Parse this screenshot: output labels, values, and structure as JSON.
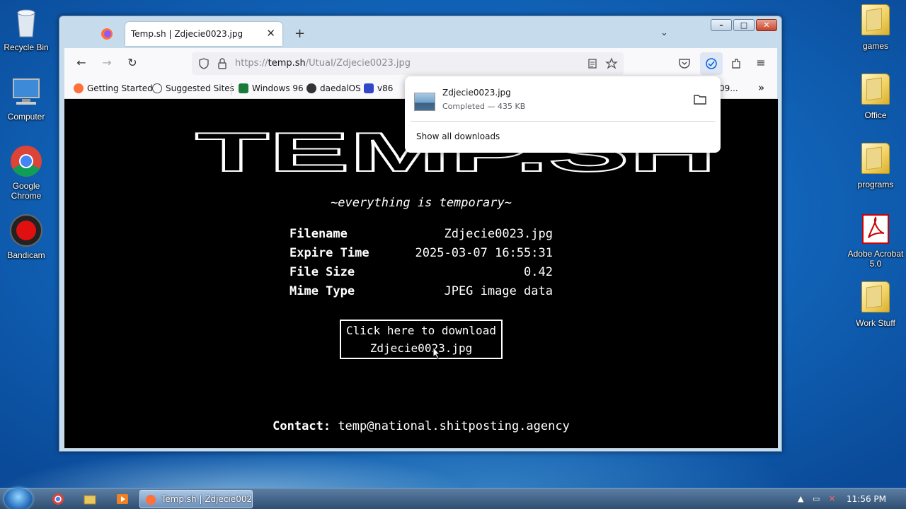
{
  "desktop": {
    "left_icons": [
      {
        "label": "Recycle Bin"
      },
      {
        "label": "Computer"
      },
      {
        "label": "Google Chrome"
      },
      {
        "label": "Bandicam"
      }
    ],
    "right_icons": [
      {
        "label": "games"
      },
      {
        "label": "Office"
      },
      {
        "label": "programs"
      },
      {
        "label": "Adobe Acrobat 5.0"
      },
      {
        "label": "Work Stuff"
      }
    ]
  },
  "browser": {
    "tab_title": "Temp.sh | Zdjecie0023.jpg",
    "new_tab": "+",
    "tab_close": "✕",
    "url_prefix": "https://",
    "url_host": "temp.sh",
    "url_path": "/UtuaI/Zdjecie0023.jpg",
    "bookmarks": [
      "Getting Started",
      "Suggested Sites",
      "Windows 96",
      "daedalOS",
      "v86"
    ],
    "bookmark_overflow": "09...",
    "window_buttons": {
      "minimize": "–",
      "maximize": "□",
      "close": "✕"
    }
  },
  "downloads_panel": {
    "filename": "Zdjecie0023.jpg",
    "status": "Completed — 435 KB",
    "show_all": "Show all downloads"
  },
  "page": {
    "logo_text": "TEMP.SH",
    "tagline": "~everything is temporary~",
    "info": [
      {
        "key": "Filename",
        "value": "Zdjecie0023.jpg"
      },
      {
        "key": "Expire Time",
        "value": "2025-03-07 16:55:31"
      },
      {
        "key": "File Size",
        "value": "0.42"
      },
      {
        "key": "Mime Type",
        "value": "JPEG image data"
      }
    ],
    "download_line1": "Click here to download",
    "download_line2": "Zdjecie0023.jpg",
    "contact_label": "Contact:",
    "contact_email": "temp@national.shitposting.agency"
  },
  "taskbar": {
    "active_task": "Temp.sh | Zdjecie002...",
    "clock": "11:56 PM"
  }
}
